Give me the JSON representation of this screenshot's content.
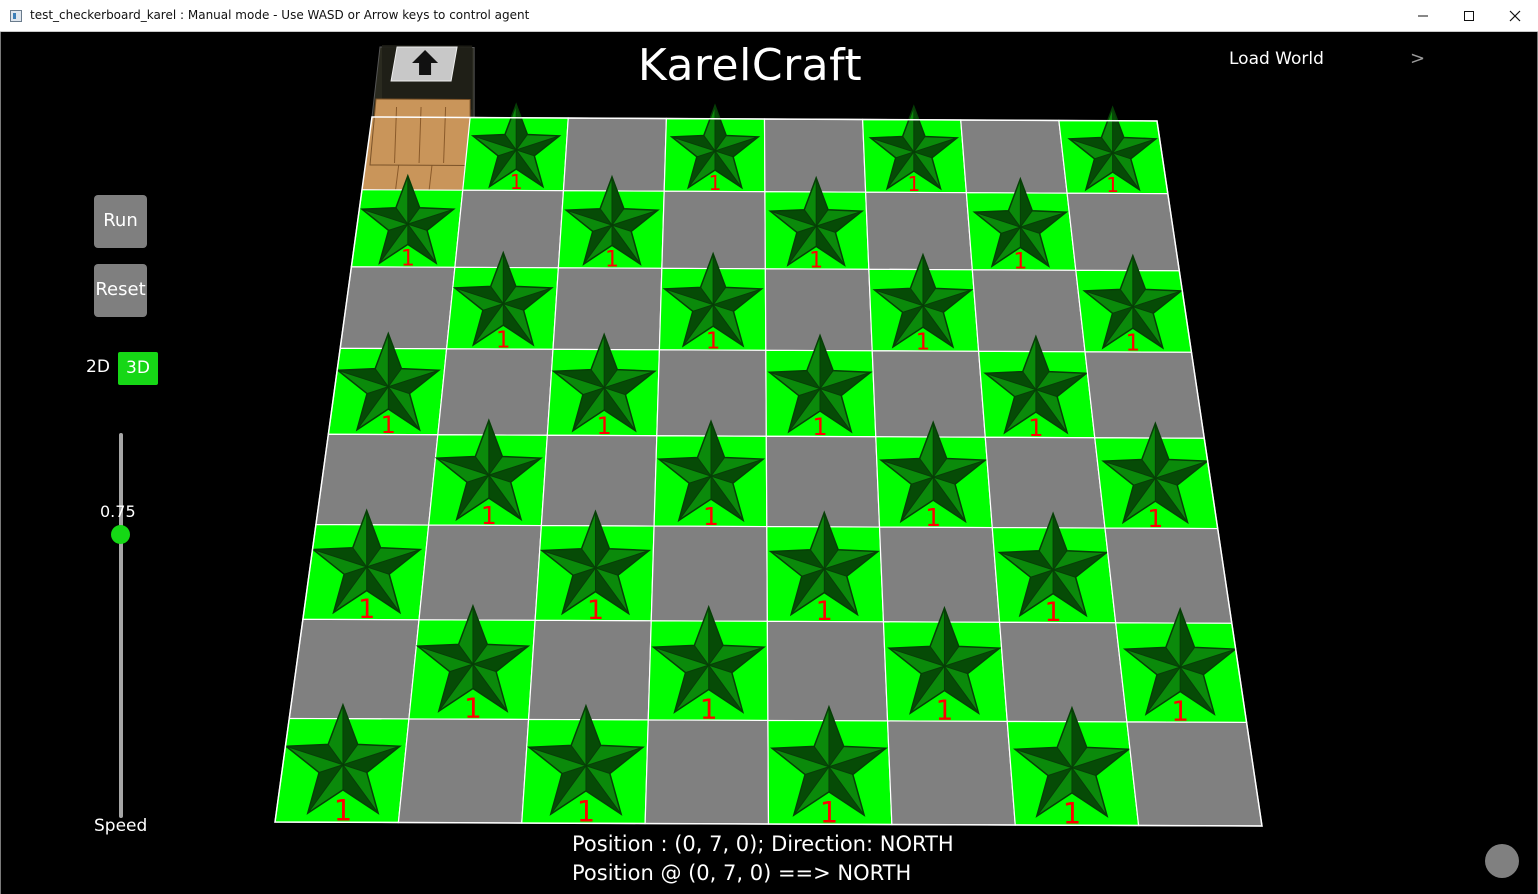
{
  "window": {
    "title": "test_checkerboard_karel : Manual mode - Use WASD or Arrow keys to control agent",
    "minimize_icon": "minimize-icon",
    "maximize_icon": "maximize-icon",
    "close_icon": "close-icon"
  },
  "header": {
    "title": "KarelCraft",
    "load_world_label": "Load World",
    "load_world_arrow": ">"
  },
  "controls": {
    "run_label": "Run",
    "reset_label": "Reset",
    "mode_2d_label": "2D",
    "mode_3d_label": "3D",
    "active_mode": "3D",
    "speed_value": "0.75",
    "speed_fraction": 0.75,
    "speed_label": "Speed"
  },
  "status": {
    "line1": "Position : (0, 7, 0); Direction: NORTH",
    "line2": "Position @ (0, 7, 0) ==> NORTH"
  },
  "board": {
    "rows": 8,
    "cols": 8,
    "beeper_count_label": "1",
    "beeper_icon": "star-beeper-icon",
    "agent": {
      "row": 0,
      "col": 0,
      "direction": "NORTH",
      "icon": "up-arrow-icon"
    },
    "colors": {
      "beeper_tile": "#00ff00",
      "empty_tile": "#808080",
      "star_fill": "#0b8a0b",
      "star_dark": "#063f06",
      "count_text": "#ff0000",
      "agent_block": "#c9955a"
    },
    "cells": [
      [
        "agent",
        "beeper",
        "empty",
        "beeper",
        "empty",
        "beeper",
        "empty",
        "beeper"
      ],
      [
        "beeper",
        "empty",
        "beeper",
        "empty",
        "beeper",
        "empty",
        "beeper",
        "empty"
      ],
      [
        "empty",
        "beeper",
        "empty",
        "beeper",
        "empty",
        "beeper",
        "empty",
        "beeper"
      ],
      [
        "beeper",
        "empty",
        "beeper",
        "empty",
        "beeper",
        "empty",
        "beeper",
        "empty"
      ],
      [
        "empty",
        "beeper",
        "empty",
        "beeper",
        "empty",
        "beeper",
        "empty",
        "beeper"
      ],
      [
        "beeper",
        "empty",
        "beeper",
        "empty",
        "beeper",
        "empty",
        "beeper",
        "empty"
      ],
      [
        "empty",
        "beeper",
        "empty",
        "beeper",
        "empty",
        "beeper",
        "empty",
        "beeper"
      ],
      [
        "beeper",
        "empty",
        "beeper",
        "empty",
        "beeper",
        "empty",
        "beeper",
        "empty"
      ]
    ]
  },
  "misc": {
    "corner_indicator_color": "#808080"
  }
}
